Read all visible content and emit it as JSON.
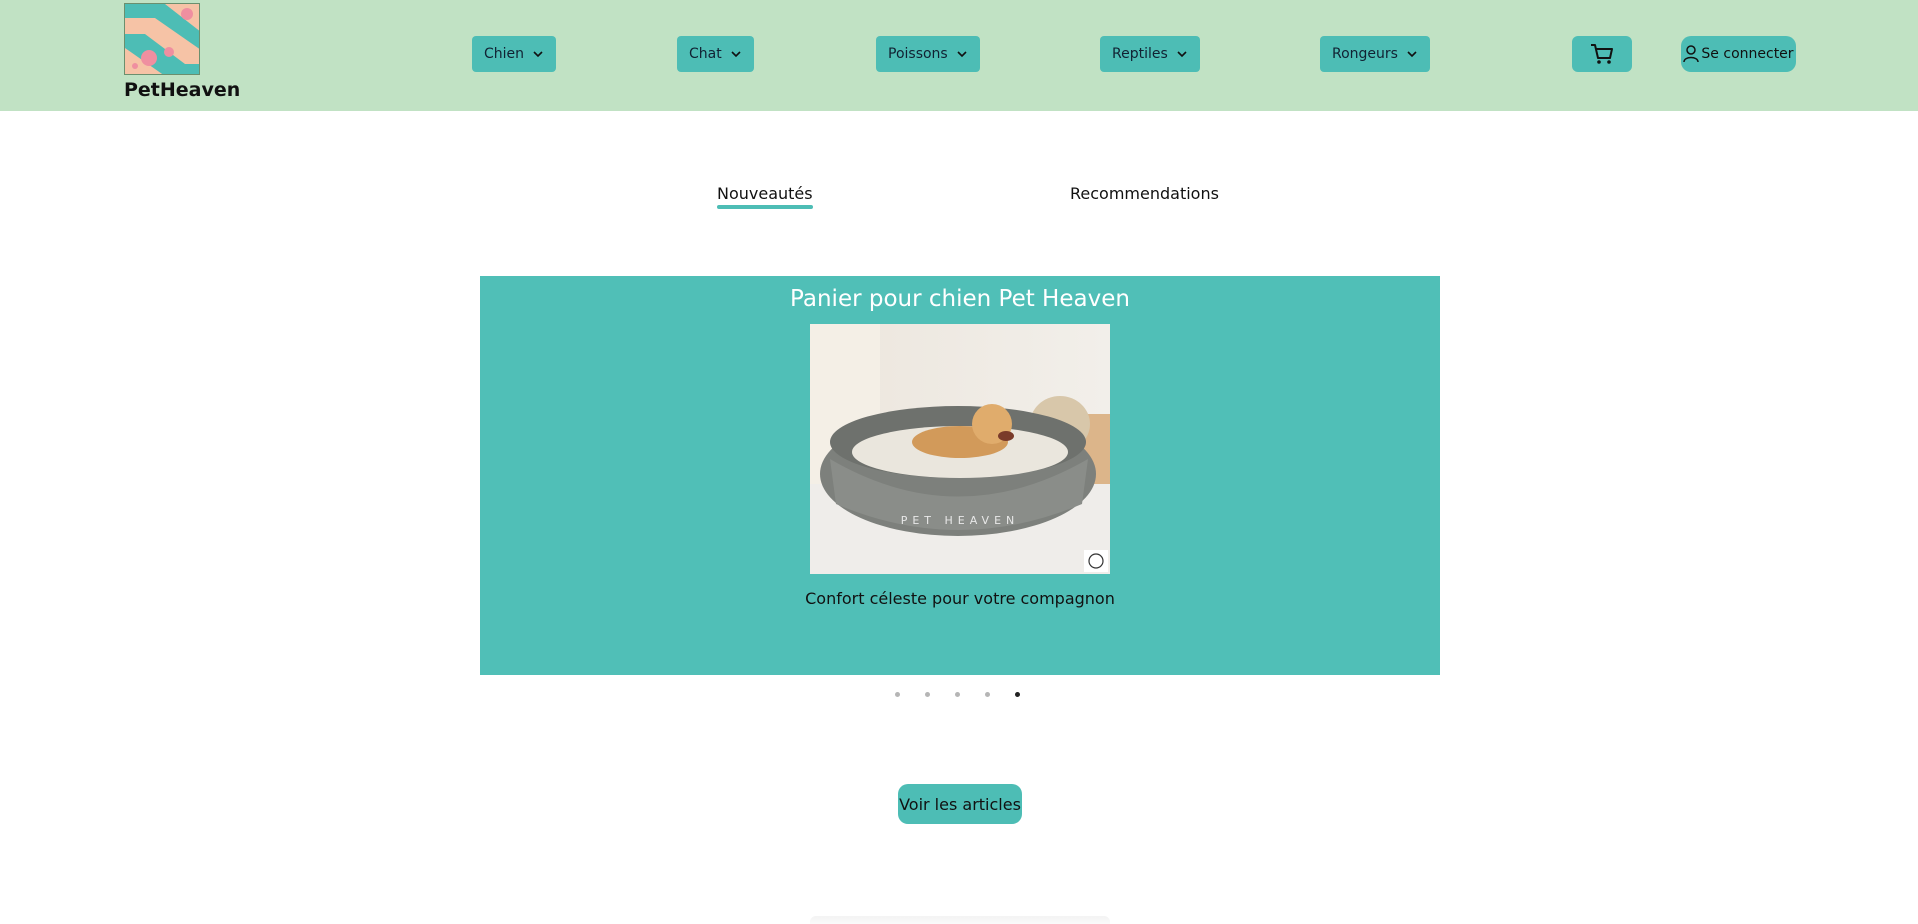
{
  "header": {
    "brand": "PetHeaven",
    "nav": [
      {
        "label": "Chien"
      },
      {
        "label": "Chat"
      },
      {
        "label": "Poissons"
      },
      {
        "label": "Reptiles"
      },
      {
        "label": "Rongeurs"
      }
    ],
    "cart_icon": "cart-icon",
    "login_label": "Se connecter",
    "login_icon": "user-icon"
  },
  "tabs": [
    {
      "label": "Nouveautés",
      "active": true
    },
    {
      "label": "Recommendations",
      "active": false
    }
  ],
  "carousel": {
    "title": "Panier pour chien Pet Heaven",
    "image_text": "PET HEAVEN",
    "caption": "Confort céleste pour votre compagnon",
    "slide_count": 5,
    "active_slide": 5
  },
  "cta_label": "Voir les articles",
  "colors": {
    "header_bg": "#c1e2c4",
    "accent": "#4dbdb5",
    "carousel_bg": "#50bfb7"
  }
}
